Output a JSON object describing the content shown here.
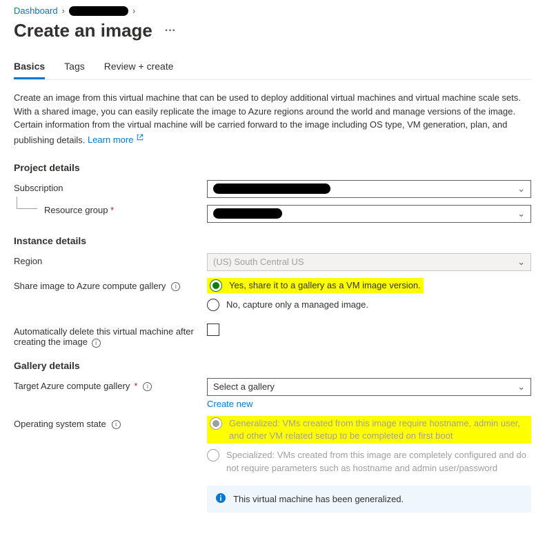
{
  "breadcrumb": {
    "dashboard": "Dashboard"
  },
  "header": {
    "title": "Create an image"
  },
  "tabs": {
    "basics": "Basics",
    "tags": "Tags",
    "review": "Review + create"
  },
  "intro": {
    "text": "Create an image from this virtual machine that can be used to deploy additional virtual machines and virtual machine scale sets. With a shared image, you can easily replicate the image to Azure regions around the world and manage versions of the image. Certain information from the virtual machine will be carried forward to the image including OS type, VM generation, plan, and publishing details. ",
    "learn_more": "Learn more"
  },
  "project": {
    "title": "Project details",
    "subscription_label": "Subscription",
    "resource_group_label": "Resource group"
  },
  "instance": {
    "title": "Instance details",
    "region_label": "Region",
    "region_value": "(US) South Central US",
    "share_label": "Share image to Azure compute gallery",
    "share_yes": "Yes, share it to a gallery as a VM image version.",
    "share_no": "No, capture only a managed image.",
    "auto_delete_label": "Automatically delete this virtual machine after creating the image"
  },
  "gallery": {
    "title": "Gallery details",
    "target_label": "Target Azure compute gallery",
    "target_placeholder": "Select a gallery",
    "create_new": "Create new",
    "os_state_label": "Operating system state",
    "generalized": "Generalized: VMs created from this image require hostname, admin user, and other VM related setup to be completed on first boot",
    "specialized": "Specialized: VMs created from this image are completely configured and do not require parameters such as hostname and admin user/password",
    "banner": "This virtual machine has been generalized."
  }
}
